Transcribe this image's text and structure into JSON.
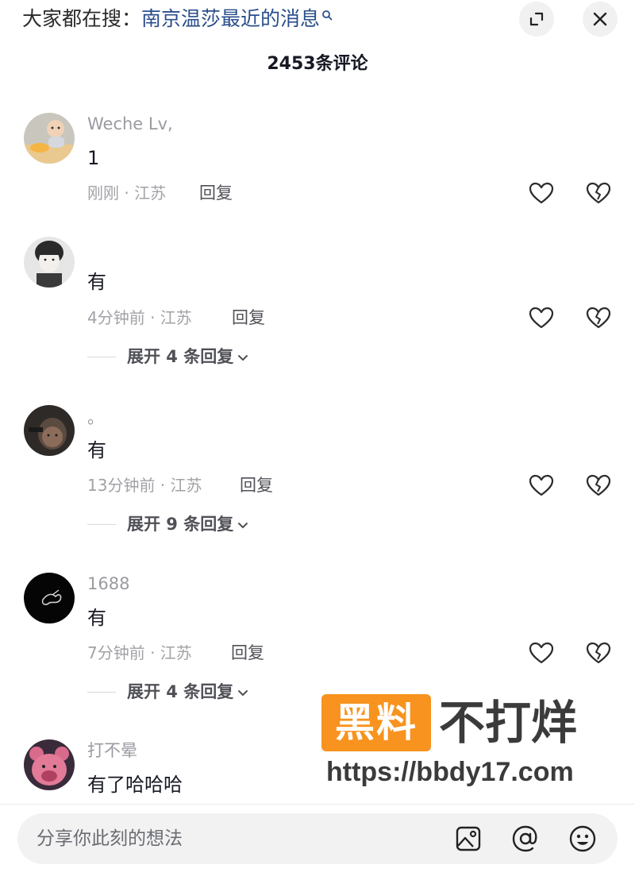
{
  "header": {
    "search_prefix": "大家都在搜：",
    "search_topic": "南京温莎最近的消息",
    "expand_icon": "expand-icon",
    "close_icon": "close-icon"
  },
  "comment_count": "2453条评论",
  "comments": [
    {
      "username": "Weche Lv,",
      "text": "1",
      "time_location": "刚刚 · 江苏",
      "reply_label": "回复",
      "avatar": "child-photo"
    },
    {
      "username": "",
      "text": "有",
      "time_location": "4分钟前 · 江苏",
      "reply_label": "回复",
      "expand_label": "展开 4 条回复",
      "avatar": "portrait-bw"
    },
    {
      "username": "。",
      "text": "有",
      "time_location": "13分钟前 · 江苏",
      "reply_label": "回复",
      "expand_label": "展开 9 条回复",
      "avatar": "dark-portrait"
    },
    {
      "username": "1688",
      "text": "有",
      "time_location": "7分钟前 · 江苏",
      "reply_label": "回复",
      "expand_label": "展开 4 条回复",
      "avatar": "black-butterfly"
    },
    {
      "username": "打不晕",
      "text": "有了哈哈哈",
      "avatar": "pink-bear"
    }
  ],
  "watermark": {
    "badge": "黑料",
    "slogan": "不打烊",
    "url": "https://bbdy17.com"
  },
  "input": {
    "placeholder": "分享你此刻的想法",
    "icons": [
      "image-icon",
      "at-icon",
      "emoji-icon"
    ]
  },
  "colors": {
    "topic_link": "#2a4e8c",
    "watermark_badge": "#f7931e",
    "text_primary": "#161823",
    "text_secondary": "#a1a2a6"
  }
}
